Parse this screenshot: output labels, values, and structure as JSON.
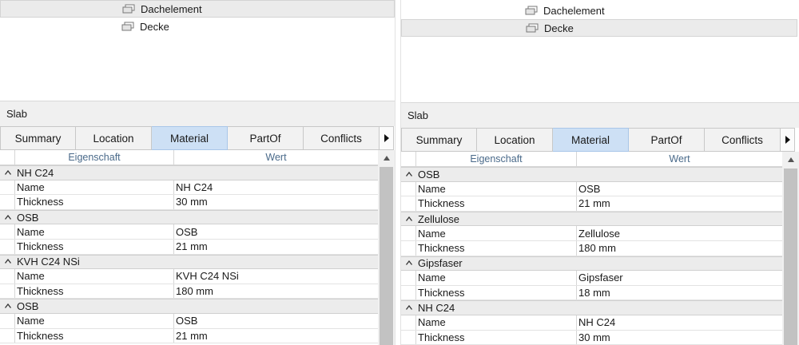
{
  "left": {
    "tree": [
      {
        "label": "Dachelement",
        "selected": true
      },
      {
        "label": "Decke",
        "selected": false
      }
    ],
    "section_title": "Slab",
    "tabs": [
      {
        "label": "Summary",
        "active": false
      },
      {
        "label": "Location",
        "active": false
      },
      {
        "label": "Material",
        "active": true
      },
      {
        "label": "PartOf",
        "active": false
      },
      {
        "label": "Conflicts",
        "active": false
      }
    ],
    "tab_arrow": "›",
    "columns": {
      "property": "Eigenschaft",
      "value": "Wert"
    },
    "groups": [
      {
        "name": "NH C24",
        "rows": [
          {
            "k": "Name",
            "v": "NH C24"
          },
          {
            "k": "Thickness",
            "v": "30 mm"
          }
        ]
      },
      {
        "name": "OSB",
        "rows": [
          {
            "k": "Name",
            "v": "OSB"
          },
          {
            "k": "Thickness",
            "v": "21 mm"
          }
        ]
      },
      {
        "name": "KVH C24 NSi",
        "rows": [
          {
            "k": "Name",
            "v": "KVH C24 NSi"
          },
          {
            "k": "Thickness",
            "v": "180 mm"
          }
        ]
      },
      {
        "name": "OSB",
        "rows": [
          {
            "k": "Name",
            "v": "OSB"
          },
          {
            "k": "Thickness",
            "v": "21 mm"
          }
        ]
      }
    ]
  },
  "right": {
    "tree": [
      {
        "label": "Dachelement",
        "selected": false
      },
      {
        "label": "Decke",
        "selected": true
      }
    ],
    "section_title": "Slab",
    "tabs": [
      {
        "label": "Summary",
        "active": false
      },
      {
        "label": "Location",
        "active": false
      },
      {
        "label": "Material",
        "active": true
      },
      {
        "label": "PartOf",
        "active": false
      },
      {
        "label": "Conflicts",
        "active": false
      }
    ],
    "tab_arrow": "›",
    "columns": {
      "property": "Eigenschaft",
      "value": "Wert"
    },
    "groups": [
      {
        "name": "OSB",
        "rows": [
          {
            "k": "Name",
            "v": "OSB"
          },
          {
            "k": "Thickness",
            "v": "21 mm"
          }
        ]
      },
      {
        "name": "Zellulose",
        "rows": [
          {
            "k": "Name",
            "v": "Zellulose"
          },
          {
            "k": "Thickness",
            "v": "180 mm"
          }
        ]
      },
      {
        "name": "Gipsfaser",
        "rows": [
          {
            "k": "Name",
            "v": "Gipsfaser"
          },
          {
            "k": "Thickness",
            "v": "18 mm"
          }
        ]
      },
      {
        "name": "NH C24",
        "rows": [
          {
            "k": "Name",
            "v": "NH C24"
          },
          {
            "k": "Thickness",
            "v": "30 mm"
          }
        ]
      }
    ]
  },
  "icons": {
    "tree_item": "slab-element-icon",
    "collapse": "collapse-caret-icon",
    "scroll_up": "scroll-up-arrow-icon",
    "tab_scroll": "tab-scroll-right-icon"
  },
  "colors": {
    "active_tab": "#cde0f5",
    "group_row": "#ececec",
    "selected_tree": "#ebebeb"
  }
}
